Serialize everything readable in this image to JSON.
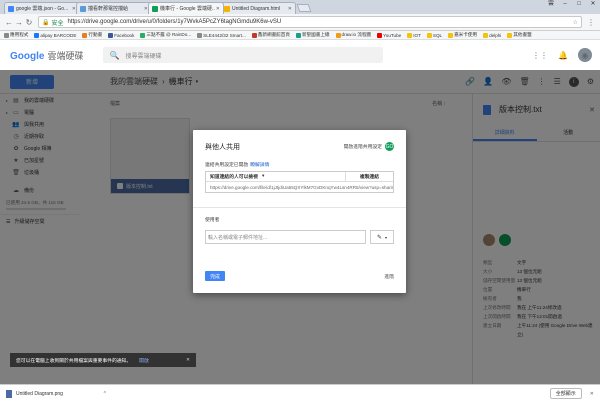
{
  "browser": {
    "tabs": [
      {
        "title": "google 雲端.json - Go...",
        "color": "#4285f4"
      },
      {
        "title": "擋看軒那電控擋給",
        "color": "#5b9bd5"
      },
      {
        "title": "機車行 - Google 雲端硬...",
        "color": "#0f9d58"
      },
      {
        "title": "Untitled Diagram.html",
        "color": "#f4b400"
      }
    ],
    "window_user": "雲",
    "url_secure": "安全",
    "url": "https://drive.google.com/drive/u/0/folders/1y7WvkA5PcZY6tagNGmdu9K6w-vSU",
    "bookmarks": [
      {
        "label": "應用程式",
        "color": "#888"
      },
      {
        "label": "alipay BARCODE",
        "color": "#1677ff"
      },
      {
        "label": "行動書",
        "color": "#e67e22"
      },
      {
        "label": "Facebook",
        "color": "#3b5998"
      },
      {
        "label": "三點不露 @ RainDo...",
        "color": "#27ae60"
      },
      {
        "label": "SLE4442/32 Smart...",
        "color": "#888"
      },
      {
        "label": "鑫新網書館首頁",
        "color": "#c0392b"
      },
      {
        "label": "新聖國書上總",
        "color": "#16a085"
      },
      {
        "label": "draw.io 流程圖",
        "color": "#f39c12"
      },
      {
        "label": "YouTube",
        "color": "#e00"
      },
      {
        "label": "IOT",
        "color": "#f1c40f"
      },
      {
        "label": "SQL",
        "color": "#f1c40f"
      },
      {
        "label": "嘉米卡使用",
        "color": "#f1c40f"
      },
      {
        "label": "delphi",
        "color": "#f1c40f"
      },
      {
        "label": "其他書籤",
        "color": "#f1c40f"
      }
    ]
  },
  "drive": {
    "logo_google": "Google",
    "logo_product": "雲端硬碟",
    "search_placeholder": "搜尋雲端硬碟",
    "new_button": "新增",
    "breadcrumb_root": "我的雲端硬碟",
    "breadcrumb_current": "機車行",
    "sidebar": [
      {
        "label": "我的雲端硬碟",
        "icon": "▤"
      },
      {
        "label": "電腦",
        "icon": "▭"
      },
      {
        "label": "與我共用",
        "icon": "👥"
      },
      {
        "label": "近期存取",
        "icon": "◷"
      },
      {
        "label": "Google 相簿",
        "icon": "✿"
      },
      {
        "label": "已加星號",
        "icon": "★"
      },
      {
        "label": "垃圾桶",
        "icon": "🗑"
      }
    ],
    "backup": "備份",
    "storage": "已使用 34.5 GB，共 115 GB",
    "upgrade": "升級儲存空間",
    "section_files": "檔案",
    "sort_label": "名稱",
    "file_name": "版本控制.txt"
  },
  "details": {
    "title": "版本控制.txt",
    "tab_details": "詳細資料",
    "tab_activity": "活動",
    "rows": [
      {
        "k": "類型",
        "v": "文字"
      },
      {
        "k": "大小",
        "v": "13 個位元組"
      },
      {
        "k": "儲存空間使用量",
        "v": "13 個位元組"
      },
      {
        "k": "位置",
        "v": "機車行"
      },
      {
        "k": "擁有者",
        "v": "我"
      },
      {
        "k": "上次修改時間",
        "v": "我在 上午11:24修改過"
      },
      {
        "k": "上次開啟時間",
        "v": "我在 下午12:01開啟過"
      },
      {
        "k": "建立日期",
        "v": "上午11:24 (使用 Google Drive Web建立)"
      }
    ]
  },
  "dialog": {
    "title": "與他人共用",
    "advanced_top": "開啟進階共用設定",
    "gicon": "GO",
    "link_label": "連結共用設定已開啟",
    "learn_more": "瞭解詳情",
    "link_permission": "知道連結的人可以檢視",
    "copy_link": "複製連結",
    "link_url": "https://drive.google.com/file/d/1jJtjdiUa55QXYlkM7GvDKnqYw4Lsn4RR5/view?usp=sharing",
    "users_label": "使用者",
    "users_placeholder": "輸入名稱或電子郵件地址...",
    "done": "完成",
    "advanced_bottom": "進階"
  },
  "snackbar": {
    "text": "您可以在電腦上收到關於共用檔案與重要事件的通知。",
    "action": "開啟"
  },
  "download": {
    "file": "Untitled Diagram.png",
    "show_all": "全部顯示"
  }
}
